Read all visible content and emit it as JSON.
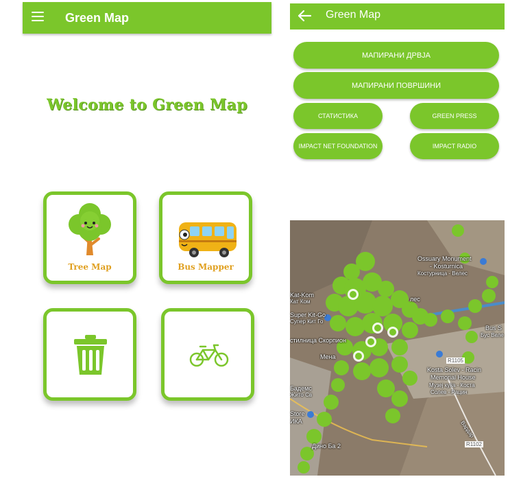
{
  "left_screen": {
    "app_title": "Green Map",
    "welcome_text": "Welcome to Green Map",
    "tiles": [
      {
        "label": "Tree Map",
        "icon": "tree-icon"
      },
      {
        "label": "Bus Mapper",
        "icon": "bus-icon"
      },
      {
        "label": "",
        "icon": "trash-can-icon"
      },
      {
        "label": "",
        "icon": "bicycle-icon"
      }
    ]
  },
  "right_screen": {
    "app_title": "Green Map",
    "buttons": {
      "mapped_trees": "МАПИРАНИ ДРВЈА",
      "mapped_areas": "МАПИРАНИ ПОВРШИНИ",
      "statistics": "СТАТИСТИКА",
      "green_press": "GREEN PRESS",
      "impact_net": "IMPACT NET FOUNDATION",
      "impact_radio": "IMPACT RADIO"
    },
    "map_labels": {
      "ossuary1": "Ossuary Monument",
      "ossuary2": "- Kosturnica",
      "kosturnica_mk": "Костурница - Велес",
      "kat_kom": "Kat-Kom",
      "kat_kom_mk": "Кат Ком",
      "super_kit": "Super Kit-Go",
      "super_kit_mk": "Супер Кит Го",
      "skorpion": "стилница Скорпион",
      "bus": "Bus S",
      "bus_mk": "Бус Веле",
      "road1": "R1105",
      "kosta1": "Kosta Solev - Racin",
      "kosta2": "Memorial House",
      "kosta3": "Музеј куќа - Коста",
      "kosta4": "Солев - Рацин",
      "vardar": "Вардар",
      "mena": "Mена",
      "badem": "Бадемс",
      "zhito": "Жито Св",
      "store": "Store",
      "ika": "ИКА",
      "dino": "Дино Ба 2",
      "road2": "R1102",
      "koles": "лес"
    },
    "colors": {
      "accent": "#7bc62b",
      "map_base": "#8a7a68"
    }
  }
}
